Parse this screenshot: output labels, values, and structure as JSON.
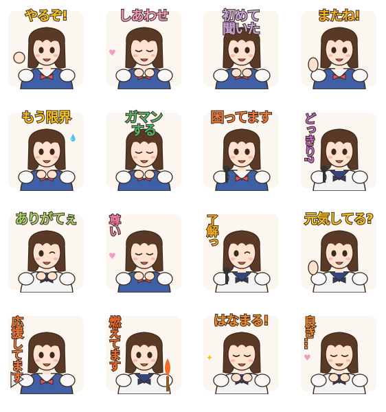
{
  "stickers": [
    {
      "caption": "やるぞ!",
      "color": "#f6c21c",
      "layout": "h",
      "pose": "fist",
      "uniform": "blue"
    },
    {
      "caption": "しあわせ",
      "color": "#f29ac0",
      "layout": "h",
      "pose": "hands-clasped",
      "uniform": "blue"
    },
    {
      "caption": "初めて\n聞いた",
      "color": "#c9a6dc",
      "layout": "h",
      "pose": "surprised",
      "uniform": "blue"
    },
    {
      "caption": "またね!",
      "color": "#f6b21c",
      "layout": "h",
      "pose": "wave",
      "uniform": "blue"
    },
    {
      "caption": "もう限界",
      "color": "#f6c21c",
      "layout": "h",
      "pose": "sweat",
      "uniform": "blue"
    },
    {
      "caption": "ガマン\nする",
      "color": "#4fb66a",
      "layout": "h",
      "pose": "endure",
      "uniform": "blue"
    },
    {
      "caption": "困ってます",
      "color": "#f07a3a",
      "layout": "h",
      "pose": "microphone",
      "uniform": "blue"
    },
    {
      "caption": "どっきり?",
      "color": "#c06ac8",
      "layout": "v",
      "pose": "microphone",
      "uniform": "sailor"
    },
    {
      "caption": "ありがてぇ",
      "color": "#a6d66c",
      "layout": "h",
      "pose": "wink-cheek",
      "uniform": "white"
    },
    {
      "caption": "尊い",
      "color": "#f07aa6",
      "layout": "v",
      "pose": "hands-cheeks",
      "uniform": "blue"
    },
    {
      "caption": "了解っ",
      "color": "#f6b21c",
      "layout": "v",
      "pose": "wink-mic",
      "uniform": "sailor"
    },
    {
      "caption": "元気してる?",
      "color": "#f6c21c",
      "layout": "h",
      "pose": "wave",
      "uniform": "sailor"
    },
    {
      "caption": "応援してます",
      "color": "#f07a3a",
      "layout": "v",
      "pose": "megaphone",
      "uniform": "blue"
    },
    {
      "caption": "燃えてます",
      "color": "#f26a2a",
      "layout": "v",
      "pose": "torch",
      "uniform": "sailor"
    },
    {
      "caption": "はなまる!",
      "color": "#f08a2a",
      "layout": "h",
      "pose": "sparkle",
      "uniform": "white"
    },
    {
      "caption": "良き…",
      "color": "#f08a2a",
      "layout": "v",
      "pose": "hands-cheeks",
      "uniform": "white"
    }
  ]
}
